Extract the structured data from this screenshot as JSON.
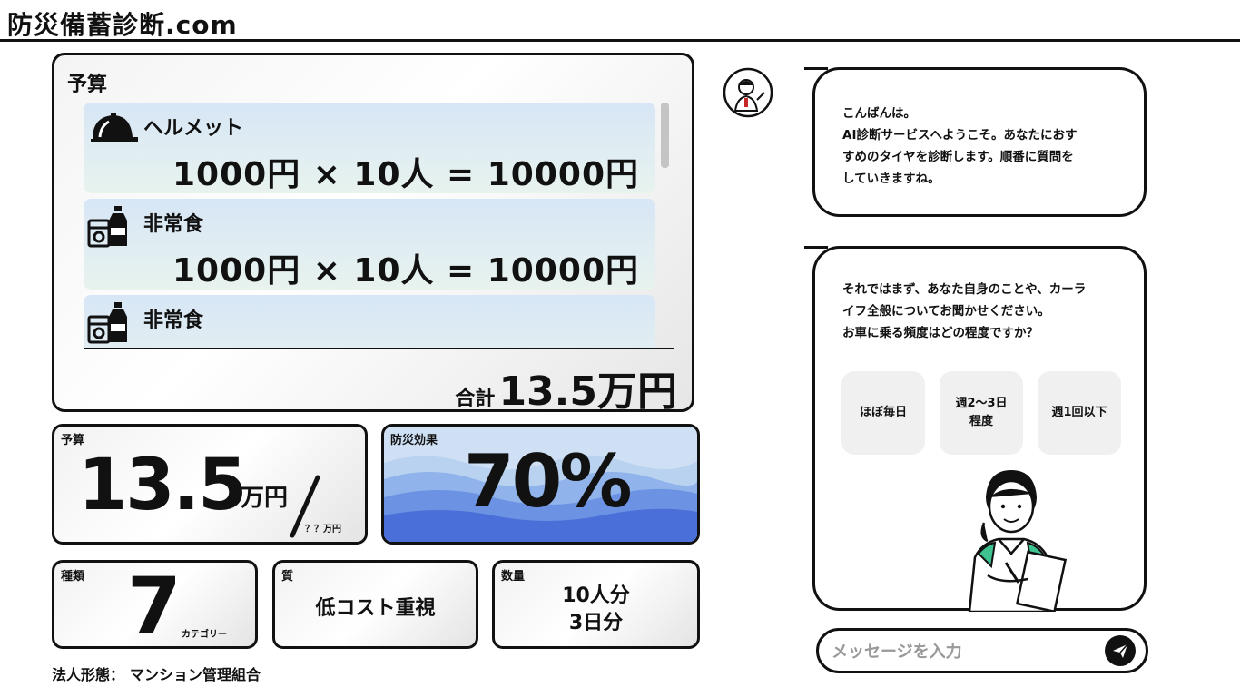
{
  "site": {
    "title": "防災備蓄診断.com"
  },
  "budget_panel": {
    "title": "予算",
    "items": [
      {
        "name": "ヘルメット",
        "calc": "1000円 × 10人 = 10000円",
        "icon": "helmet-icon"
      },
      {
        "name": "非常食",
        "calc": "1000円 × 10人 = 10000円",
        "icon": "emergency-food-icon"
      },
      {
        "name": "非常食",
        "calc": "",
        "icon": "emergency-food-icon"
      }
    ],
    "total_label": "合計",
    "total_value": "13.5万円"
  },
  "stats": {
    "budget": {
      "label": "予算",
      "amount": "13.5",
      "unit": "万円",
      "limit": "？？万円"
    },
    "effect": {
      "label": "防災効果",
      "value": "70%"
    },
    "kinds": {
      "label": "種類",
      "value": "7",
      "unit": "カテゴリー"
    },
    "quality": {
      "label": "質",
      "value": "低コスト重視"
    },
    "quantity": {
      "label": "数量",
      "line1": "10人分",
      "line2": "3日分"
    }
  },
  "corp_type": {
    "label": "法人形態：",
    "value": "マンション管理組合"
  },
  "chat": {
    "bubble1": [
      "こんばんは。",
      "AI診断サービスへようこそ。あなたにおす",
      "すめのタイヤを診断します。順番に質問を",
      "していきますね。"
    ],
    "bubble2": [
      "それではまず、あなた自身のことや、カーラ",
      "イフ全般についてお聞かせください。",
      "お車に乗る頻度はどの程度ですか？"
    ],
    "choices": [
      "ほぼ毎日",
      "週2〜3日\n程度",
      "週1回以下"
    ],
    "input_placeholder": "メッセージを入力"
  },
  "colors": {
    "accent": "#111111",
    "card_blue": "#cfe0f5",
    "wave_dark": "#4a6fd8"
  }
}
